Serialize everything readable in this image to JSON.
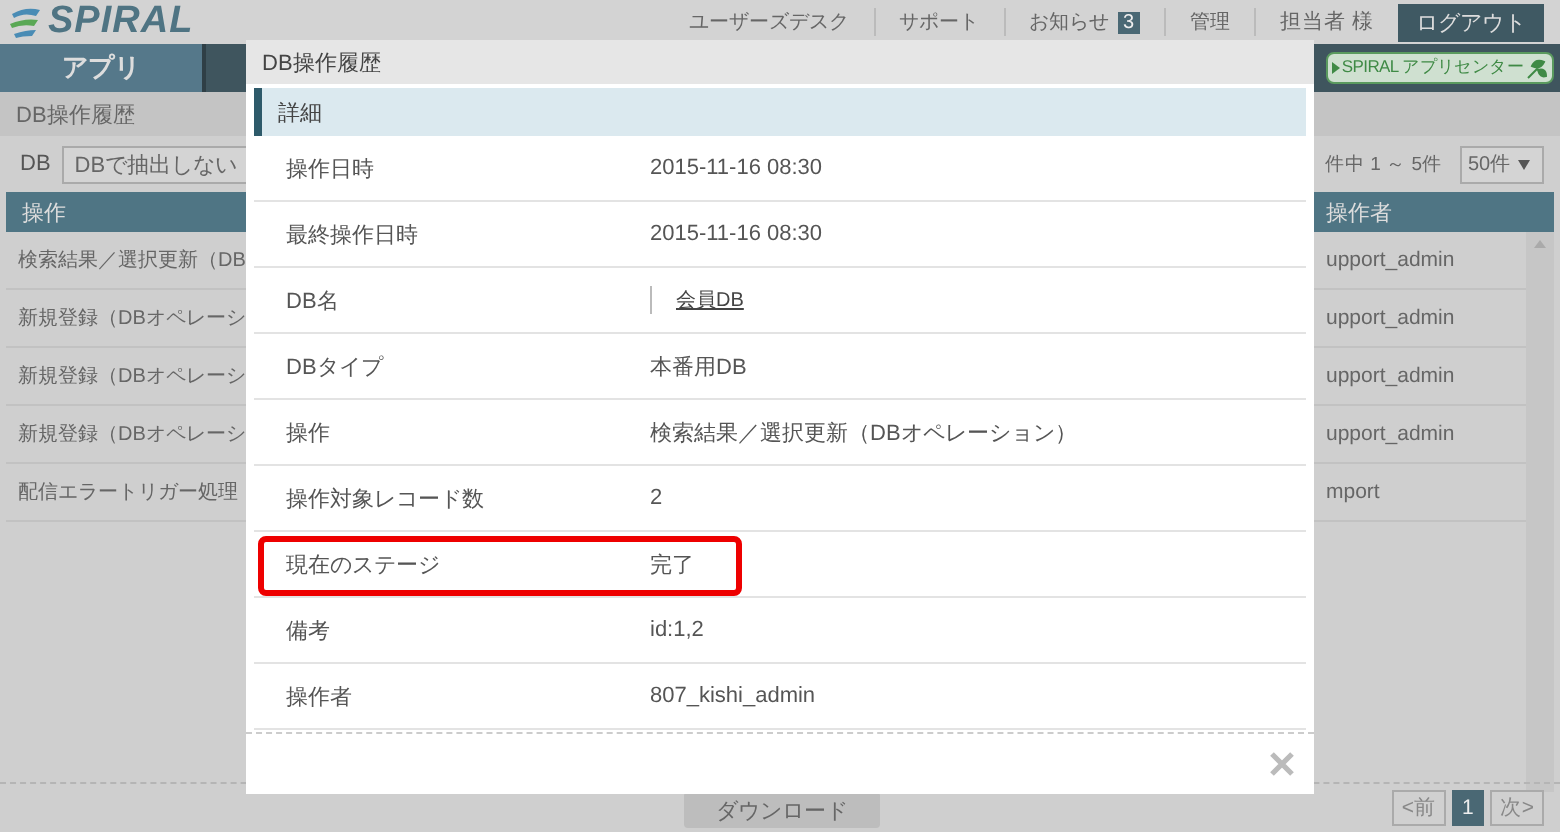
{
  "header": {
    "logo": "SPIRAL",
    "links": [
      {
        "label": "ユーザーズデスク"
      },
      {
        "label": "サポート"
      },
      {
        "label": "お知らせ",
        "badge": "3"
      },
      {
        "label": "管理"
      }
    ],
    "user": "担当者 様",
    "logout": "ログアウト"
  },
  "nav": {
    "tabs": [
      {
        "label": "アプリ",
        "selected": true
      }
    ],
    "app_center": "SPIRAL アプリセンター"
  },
  "breadcrumb": "DB操作履歴",
  "filter": {
    "db_label": "DB",
    "db_select": "DBで抽出しない",
    "count": "件中 1 ～ 5件",
    "per_page": "50件"
  },
  "table": {
    "columns": [
      "操作",
      "操作者"
    ],
    "rows": [
      {
        "operation": "検索結果／選択更新（DB",
        "operator": "upport_admin"
      },
      {
        "operation": "新規登録（DBオペレーシ",
        "operator": "upport_admin"
      },
      {
        "operation": "新規登録（DBオペレーシ",
        "operator": "upport_admin"
      },
      {
        "operation": "新規登録（DBオペレーシ",
        "operator": "upport_admin"
      },
      {
        "operation": "配信エラートリガー処理",
        "operator": "mport"
      }
    ]
  },
  "download": "ダウンロード",
  "pagination": [
    {
      "label": "<前",
      "selected": false
    },
    {
      "label": "1",
      "selected": true
    },
    {
      "label": "次>",
      "selected": false
    }
  ],
  "modal": {
    "title": "DB操作履歴",
    "section": "詳細",
    "rows": [
      {
        "label": "操作日時",
        "value": "2015-11-16 08:30",
        "kind": "text",
        "highlighted": false
      },
      {
        "label": "最終操作日時",
        "value": "2015-11-16 08:30",
        "kind": "text",
        "highlighted": false
      },
      {
        "label": "DB名",
        "value": "会員DB",
        "kind": "link",
        "highlighted": false
      },
      {
        "label": "DBタイプ",
        "value": "本番用DB",
        "kind": "text",
        "highlighted": false
      },
      {
        "label": "操作",
        "value": "検索結果／選択更新（DBオペレーション）",
        "kind": "text",
        "highlighted": false
      },
      {
        "label": "操作対象レコード数",
        "value": "2",
        "kind": "text",
        "highlighted": false
      },
      {
        "label": "現在のステージ",
        "value": "完了",
        "kind": "text",
        "highlighted": true
      },
      {
        "label": "備考",
        "value": "id:1,2",
        "kind": "text",
        "highlighted": false
      },
      {
        "label": "操作者",
        "value": "807_kishi_admin",
        "kind": "text",
        "highlighted": false
      }
    ]
  }
}
